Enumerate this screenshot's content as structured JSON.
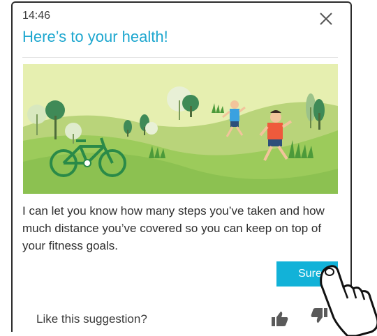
{
  "status": {
    "time": "14:46"
  },
  "header": {
    "title": "Here’s to your health!"
  },
  "body": {
    "message": "I can let you know how many steps you’ve taken and how much distance you’ve covered so you can keep on top of your fitness goals."
  },
  "actions": {
    "sure_label": "Sure"
  },
  "feedback": {
    "prompt": "Like this suggestion?"
  },
  "icons": {
    "close": "close-icon",
    "thumb_up": "thumb-up-icon",
    "thumb_down": "thumb-down-icon",
    "illustration": "park-exercise-illustration",
    "hand": "pointing-hand-icon"
  },
  "colors": {
    "accent": "#1ea7cf",
    "button": "#12b2d8",
    "grass": "#8cc151",
    "bike": "#2a8a48"
  }
}
